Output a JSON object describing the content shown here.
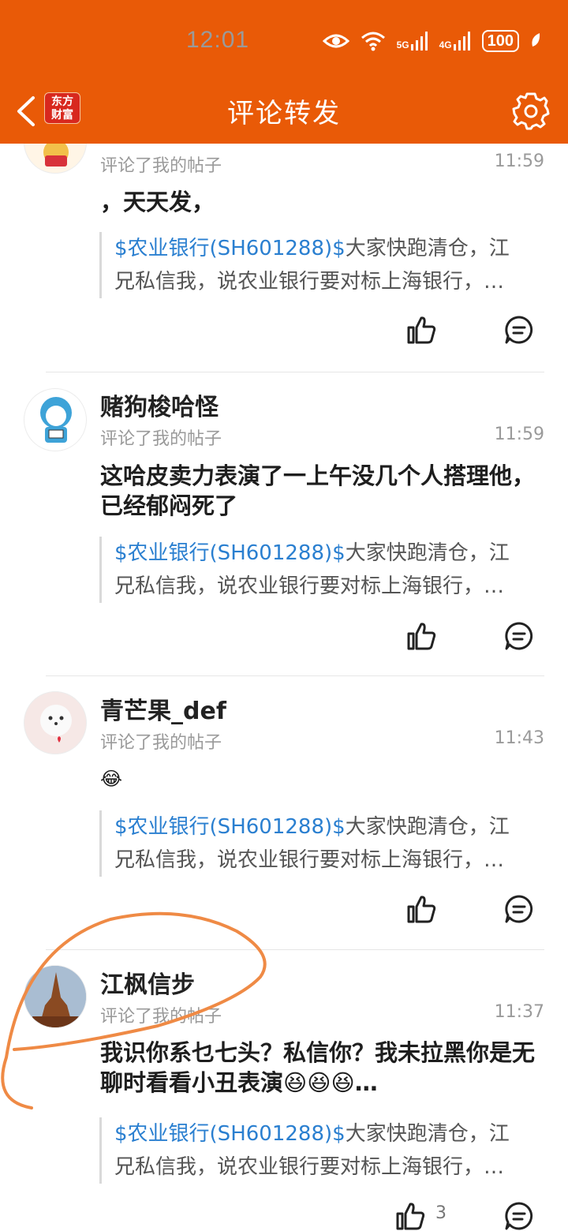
{
  "status_bar": {
    "time": "12:01",
    "signal1": "5G",
    "signal2": "4G",
    "battery": "100"
  },
  "nav": {
    "logo_line1": "东方",
    "logo_line2": "财富",
    "title": "评论转发"
  },
  "colors": {
    "brand": "#e95a07",
    "link": "#2a7fd0",
    "annotation": "#ef8a45"
  },
  "comments": [
    {
      "name": "",
      "action": "评论了我的帖子",
      "time": "11:59",
      "text": "，天天发，",
      "quote_stock": "$农业银行(SH601288)$",
      "quote_line1_rest": "大家快跑清仓，江",
      "quote_line2": "兄私信我，说农业银行要对标上海银行，…",
      "likes": ""
    },
    {
      "name": "赌狗梭哈怪",
      "action": "评论了我的帖子",
      "time": "11:59",
      "text": "这哈皮卖力表演了一上午没几个人搭理他，已经郁闷死了",
      "quote_stock": "$农业银行(SH601288)$",
      "quote_line1_rest": "大家快跑清仓，江",
      "quote_line2": "兄私信我，说农业银行要对标上海银行，…",
      "likes": ""
    },
    {
      "name": "青芒果_def",
      "action": "评论了我的帖子",
      "time": "11:43",
      "text": "😂",
      "quote_stock": "$农业银行(SH601288)$",
      "quote_line1_rest": "大家快跑清仓，江",
      "quote_line2": "兄私信我，说农业银行要对标上海银行，…",
      "likes": ""
    },
    {
      "name": "江枫信步",
      "action": "评论了我的帖子",
      "time": "11:37",
      "text": "我识你系乜七头？私信你？我未拉黑你是无聊时看看小丑表演😆😆😆…",
      "quote_stock": "$农业银行(SH601288)$",
      "quote_line1_rest": "大家快跑清仓，江",
      "quote_line2": "兄私信我，说农业银行要对标上海银行，…",
      "likes": "3"
    }
  ]
}
